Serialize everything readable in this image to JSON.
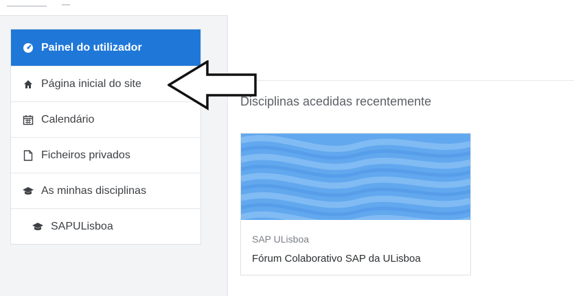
{
  "sidebar": {
    "items": [
      {
        "label": "Painel do utilizador",
        "icon": "dashboard-icon"
      },
      {
        "label": "Página inicial do site",
        "icon": "home-icon"
      },
      {
        "label": "Calendário",
        "icon": "calendar-icon"
      },
      {
        "label": "Ficheiros privados",
        "icon": "file-icon"
      },
      {
        "label": "As minhas disciplinas",
        "icon": "graduation-cap-icon"
      },
      {
        "label": "SAPULisboa",
        "icon": "graduation-cap-icon"
      }
    ]
  },
  "main": {
    "section_title": "Disciplinas acedidas recentemente",
    "course": {
      "category": "SAP ULisboa",
      "name": "Fórum Colaborativo SAP da ULisboa"
    }
  },
  "colors": {
    "accent": "#1f77d8",
    "card_image": "#62a8ef"
  }
}
